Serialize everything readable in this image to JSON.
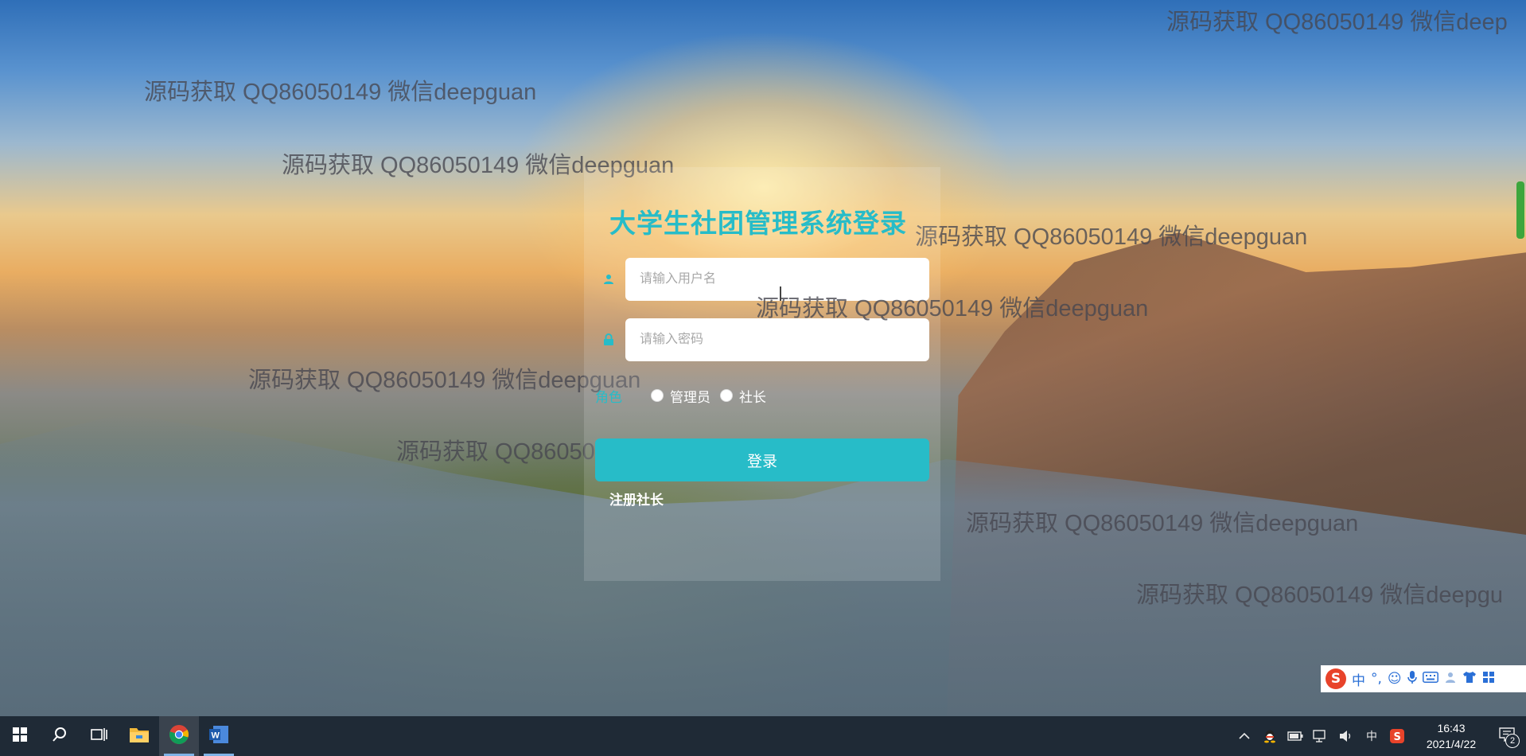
{
  "login": {
    "title": "大学生社团管理系统登录",
    "username_placeholder": "请输入用户名",
    "password_placeholder": "请输入密码",
    "role_label": "角色",
    "role_options": [
      "管理员",
      "社长"
    ],
    "submit_label": "登录",
    "register_label": "注册社长"
  },
  "watermark_text": "源码获取 QQ86050149 微信deepguan",
  "watermarks": [
    {
      "text": "源码获取 QQ86050149 微信deep"
    },
    {
      "text": "源码获取 QQ86050149 微信deepguan"
    },
    {
      "text": "源码获取 QQ86050149 微信deepguan"
    },
    {
      "text": "源码获取 QQ86050149 微信deepguan"
    },
    {
      "text": "源码获取 QQ86050149 微信deepguan"
    },
    {
      "text": "源码获取 QQ86050149 微信deepguan"
    },
    {
      "text": "源码获取 QQ86050149 微信deepguan"
    },
    {
      "text": "源码获取 QQ86050149 微信deepguan"
    },
    {
      "text": "源码获取 QQ86050149 微信deepgu"
    }
  ],
  "ime": {
    "logo": "S",
    "items": [
      "中",
      "°,",
      "☺",
      "🎤",
      "⌨",
      "👕",
      "▦"
    ]
  },
  "taskbar": {
    "apps": [
      {
        "name": "start",
        "icon": "windows-icon"
      },
      {
        "name": "search",
        "icon": "search-icon"
      },
      {
        "name": "task-view",
        "icon": "task-view-icon"
      },
      {
        "name": "file-explorer",
        "icon": "folder-icon"
      },
      {
        "name": "chrome",
        "icon": "chrome-icon"
      },
      {
        "name": "word",
        "icon": "word-icon"
      }
    ],
    "tray_lang": "中",
    "time": "16:43",
    "date": "2021/4/22",
    "notification_count": "2"
  },
  "colors": {
    "accent": "#27bcc8",
    "taskbar": "#1f2a36"
  }
}
